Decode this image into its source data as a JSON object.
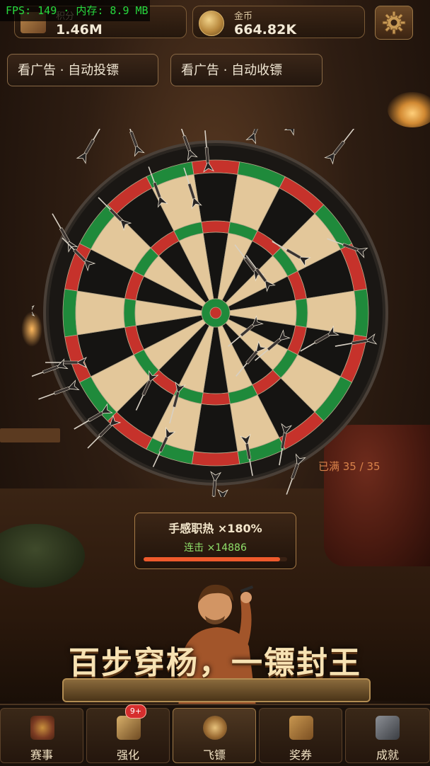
{
  "debug": {
    "fps_text": "FPS: 149 · 内存: 8.9 MB"
  },
  "header": {
    "score": {
      "label": "积分",
      "value": "1.46M",
      "icon": "scroll-icon"
    },
    "gold": {
      "label": "金币",
      "value": "664.82K",
      "icon": "coin-icon"
    },
    "settings_icon": "gear-icon"
  },
  "ads": {
    "auto_throw": "看广告 · 自动投镖",
    "auto_collect": "看广告 · 自动收镖"
  },
  "board": {
    "capacity_text": "已满 35 / 35",
    "colors": {
      "dark": "#151412",
      "light": "#e3c79a",
      "red": "#c6322b",
      "green": "#1f8a3b",
      "frame": "#2b2621"
    }
  },
  "combo": {
    "title": "手感职热 ×180%",
    "streak": "连击 ×14886",
    "fill": 0.95
  },
  "slogan": "百步穿杨，一镖封王",
  "nav": {
    "items": [
      {
        "label": "赛事",
        "icon": "target-icon",
        "badge": ""
      },
      {
        "label": "强化",
        "icon": "upgrade-icon",
        "badge": "9+"
      },
      {
        "label": "飞镖",
        "icon": "dart-icon",
        "badge": ""
      },
      {
        "label": "奖券",
        "icon": "ticket-icon",
        "badge": ""
      },
      {
        "label": "成就",
        "icon": "trophy-icon",
        "badge": ""
      }
    ],
    "active_index": 2
  }
}
